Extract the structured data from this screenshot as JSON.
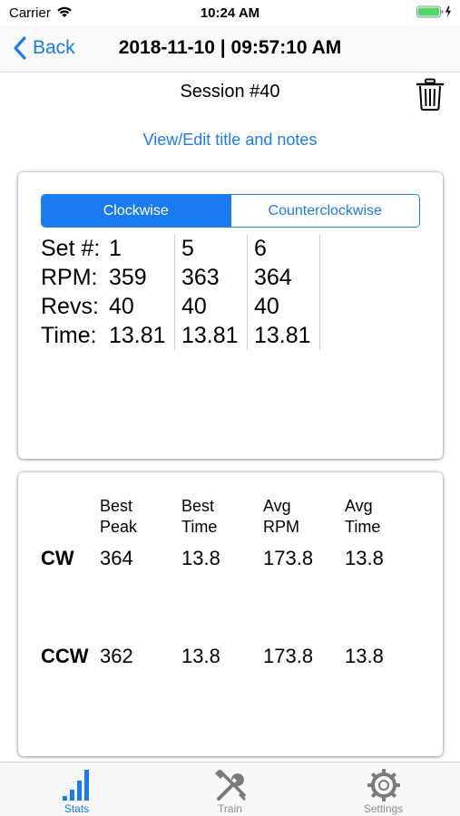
{
  "status_bar": {
    "carrier": "Carrier",
    "time": "10:24 AM"
  },
  "nav": {
    "back_label": "Back",
    "title": "2018-11-10 | 09:57:10 AM"
  },
  "session": {
    "title": "Session #40",
    "edit_link": "View/Edit title and notes"
  },
  "direction_tabs": [
    {
      "label": "Clockwise",
      "selected": true
    },
    {
      "label": "Counterclockwise",
      "selected": false
    }
  ],
  "set_labels": [
    "Set #:",
    "RPM:",
    "Revs:",
    "Time:"
  ],
  "sets": [
    {
      "set": "1",
      "rpm": "359",
      "revs": "40",
      "time": "13.81"
    },
    {
      "set": "5",
      "rpm": "363",
      "revs": "40",
      "time": "13.81"
    },
    {
      "set": "6",
      "rpm": "364",
      "revs": "40",
      "time": "13.81"
    }
  ],
  "summary": {
    "headers": [
      "Best\nPeak",
      "Best\nTime",
      "Avg\nRPM",
      "Avg\nTime"
    ],
    "rows": [
      {
        "label": "CW",
        "values": [
          "364",
          "13.8",
          "173.8",
          "13.8"
        ]
      },
      {
        "label": "CCW",
        "values": [
          "362",
          "13.8",
          "173.8",
          "13.8"
        ]
      }
    ]
  },
  "tabs": [
    {
      "label": "Stats",
      "icon": "bar-chart-icon",
      "active": true
    },
    {
      "label": "Train",
      "icon": "tools-icon",
      "active": false
    },
    {
      "label": "Settings",
      "icon": "gear-icon",
      "active": false
    }
  ],
  "colors": {
    "accent": "#1a7bf1",
    "inactive_tab": "#8e8e93",
    "battery": "#4cd964"
  }
}
